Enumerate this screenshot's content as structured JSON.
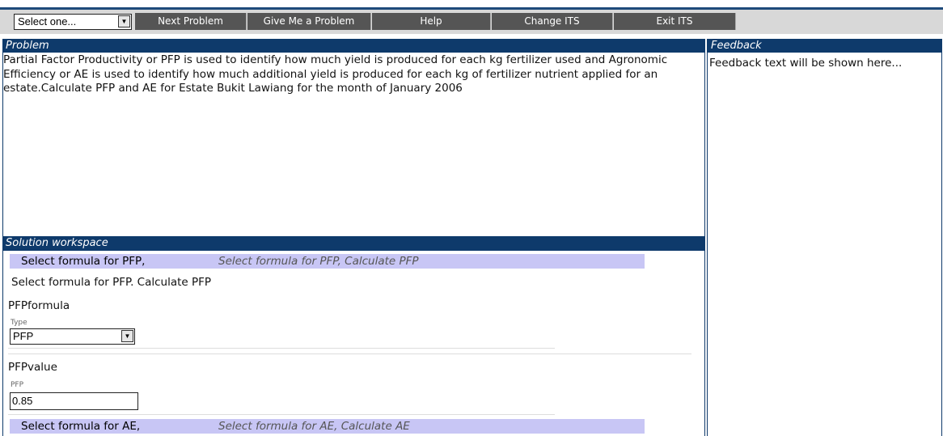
{
  "toolbar": {
    "select_value": "Select one...",
    "buttons": [
      "Next Problem",
      "Give Me a Problem",
      "Help",
      "Change ITS",
      "Exit ITS"
    ]
  },
  "problem": {
    "header": "Problem",
    "text": "Partial Factor Productivity or PFP is used to identify how much yield is produced for each kg fertilizer used and Agronomic Efficiency or AE is used to identify how much additional yield is produced for each kg of fertilizer nutrient applied for an estate.Calculate PFP and AE for Estate Bukit Lawiang for the month of January 2006"
  },
  "feedback": {
    "header": "Feedback",
    "text": "Feedback text will be shown here..."
  },
  "workspace": {
    "header": "Solution workspace",
    "step1": {
      "label": "Select formula for PFP,",
      "hint": "Select formula for PFP, Calculate PFP"
    },
    "step1_desc": "Select formula for PFP. Calculate PFP",
    "pfp_formula_label": "PFPformula",
    "type_caption": "Type",
    "type_value": "PFP",
    "pfp_value_label": "PFPvalue",
    "pfp_caption": "PFP",
    "pfp_value": "0.85",
    "step2": {
      "label": "Select formula for AE,",
      "hint": "Select formula for AE, Calculate AE"
    }
  },
  "colors": {
    "header_bg": "#0e3a6b",
    "nav_bg": "#555555",
    "step_bar": "#c8c6f5"
  }
}
